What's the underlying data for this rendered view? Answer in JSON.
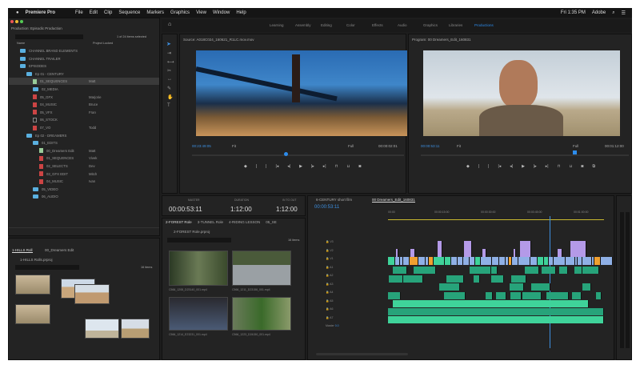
{
  "menubar": {
    "app": "Premiere Pro",
    "items": [
      "File",
      "Edit",
      "Clip",
      "Sequence",
      "Markers",
      "Graphics",
      "View",
      "Window",
      "Help"
    ],
    "clock": "Fri 1:35 PM",
    "user": "Adobe"
  },
  "workspaces": [
    "Learning",
    "Assembly",
    "Editing",
    "Color",
    "Effects",
    "Audio",
    "Graphics",
    "Libraries",
    "Productions"
  ],
  "active_workspace": "Productions",
  "project": {
    "title": "Production: Episodic Production",
    "status": "1 of 24 items selected",
    "col_name": "Name",
    "col_locked": "Project Locked",
    "rows": [
      {
        "name": "CHANNEL BRAND ELEMENTS",
        "type": "folder",
        "depth": 1,
        "user": ""
      },
      {
        "name": "CHANNEL TRAILER",
        "type": "folder",
        "depth": 1,
        "user": ""
      },
      {
        "name": "EPISODES",
        "type": "folder",
        "depth": 1,
        "user": ""
      },
      {
        "name": "Ep 01 - CENTURY",
        "type": "folder",
        "depth": 2,
        "user": ""
      },
      {
        "name": "01_SEQUENCES",
        "type": "seq",
        "depth": 3,
        "user": "Matt",
        "selected": true
      },
      {
        "name": "02_MEDIA",
        "type": "folder",
        "depth": 3,
        "user": ""
      },
      {
        "name": "05_GFX",
        "type": "file",
        "depth": 3,
        "user": "Marjorie"
      },
      {
        "name": "04_MUSIC",
        "type": "file",
        "depth": 3,
        "user": "Bruce"
      },
      {
        "name": "05_VFX",
        "type": "file",
        "depth": 3,
        "user": "Fran"
      },
      {
        "name": "06_STOCK",
        "type": "blank",
        "depth": 3,
        "user": ""
      },
      {
        "name": "07_VO",
        "type": "file",
        "depth": 3,
        "user": "Todd"
      },
      {
        "name": "Ep 02 - DREAMERS",
        "type": "folder",
        "depth": 2,
        "user": ""
      },
      {
        "name": "01_EDITS",
        "type": "folder",
        "depth": 3,
        "user": ""
      },
      {
        "name": "00_Dreamers Edit",
        "type": "seq",
        "depth": 4,
        "user": "Matt"
      },
      {
        "name": "01_SEQUENCES",
        "type": "file",
        "depth": 4,
        "user": "Vivek"
      },
      {
        "name": "02_SELECTS",
        "type": "file",
        "depth": 4,
        "user": "Dev"
      },
      {
        "name": "03_GFX EDIT",
        "type": "file",
        "depth": 4,
        "user": "Mitch"
      },
      {
        "name": "04_MUSIC",
        "type": "file",
        "depth": 4,
        "user": "Ivan"
      },
      {
        "name": "05_VIDEO",
        "type": "folder",
        "depth": 3,
        "user": ""
      },
      {
        "name": "06_AUDIO",
        "type": "folder",
        "depth": 3,
        "user": ""
      }
    ]
  },
  "bin_left": {
    "tabs": [
      "1-HILLS Roll",
      "00_Dreamers Edit"
    ],
    "path": "1-HILLS Rolls.prproj",
    "count": "16 items"
  },
  "bin_center": {
    "tabs": [
      "2-FOREST Role",
      "3-TUNNEL Role",
      "4-RIDING LESSON",
      "05_SE"
    ],
    "path": "2-FOREST Role.prproj",
    "count": "16 items",
    "clips": [
      "C566_1208_D23140_001.mp4",
      "C566_1211_D23156_001.mp4",
      "C566_1214_E23231_001.mp4",
      "C566_1223_D24150_001.mp4"
    ]
  },
  "source": {
    "title": "Source: A018C024_160621_R1LC.mov.mov",
    "timecode": "00:23:49:05",
    "fit": "Fit",
    "quality": "Full",
    "duration": "00:00:02:01"
  },
  "program": {
    "title": "Program: 00 Dreamers_Edit_160831",
    "timecode": "00:00:53:11",
    "fit": "Fit",
    "quality": "Full",
    "duration": "00:01:12:00"
  },
  "metadata": {
    "labels": [
      "MASTER",
      "DURATION",
      "IN TO OUT"
    ],
    "values": [
      "00:00:53:11",
      "1:12:00",
      "1:12:00"
    ]
  },
  "timeline": {
    "tabs": [
      "6-CENTURY short film",
      "00 Dreamers_Edit_160831"
    ],
    "timecode": "00:00:53:11",
    "ruler": [
      "00:00",
      "00:00:15:00",
      "00:00:30:00",
      "00:00:45:00",
      "00:01:00:00"
    ],
    "video_tracks": [
      "V3",
      "V2",
      "V1"
    ],
    "audio_tracks": [
      "A1",
      "A2",
      "A3",
      "A4",
      "A5",
      "A6",
      "A7"
    ],
    "master": "Master",
    "master_val": "0.0"
  },
  "colors": {
    "accent": "#2d8ceb",
    "video_clip": "#8fb0e6",
    "graphic_clip": "#b49ae8",
    "audio_clip": "#27a37a",
    "audio_light": "#3fd39a",
    "orange_clip": "#f0a030"
  }
}
